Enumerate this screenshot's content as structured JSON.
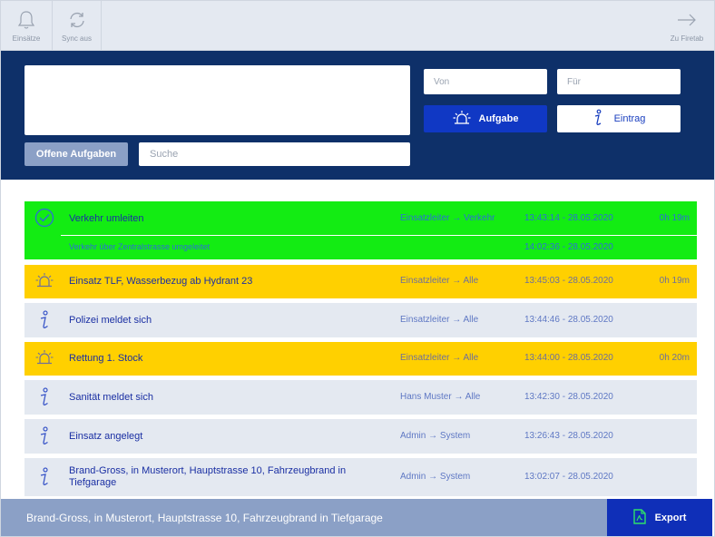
{
  "toolbar": {
    "einsaetze_label": "Einsätze",
    "sync_label": "Sync aus",
    "firetab_label": "Zu Firetab"
  },
  "panel": {
    "von_placeholder": "Von",
    "fuer_placeholder": "Für",
    "aufgabe_label": "Aufgabe",
    "eintrag_label": "Eintrag",
    "offene_label": "Offene Aufgaben",
    "suche_placeholder": "Suche"
  },
  "colors": {
    "panel_bg": "#0e3069",
    "done_green": "#13ec13",
    "alarm_yellow": "#ffd000",
    "info_grey": "#e4e9f1",
    "accent_blue": "#1038c4"
  },
  "entries": [
    {
      "type": "task-done",
      "icon": "check-circle-icon",
      "title": "Verkehr umleiten",
      "route": "Einsatzleiter → Verkehr",
      "time": "13:43:14 - 28.05.2020",
      "duration": "0h 19m",
      "sub": {
        "text": "Verkehr über Zentralstrasse umgeleitet",
        "time": "14:02:36 - 28.05.2020"
      }
    },
    {
      "type": "alarm",
      "icon": "siren-icon",
      "title": "Einsatz TLF, Wasserbezug ab Hydrant 23",
      "route": "Einsatzleiter → Alle",
      "time": "13:45:03 - 28.05.2020",
      "duration": "0h 19m"
    },
    {
      "type": "info",
      "icon": "info-icon",
      "title": "Polizei meldet sich",
      "route": "Einsatzleiter → Alle",
      "time": "13:44:46 - 28.05.2020",
      "duration": ""
    },
    {
      "type": "alarm",
      "icon": "siren-icon",
      "title": "Rettung 1. Stock",
      "route": "Einsatzleiter → Alle",
      "time": "13:44:00 - 28.05.2020",
      "duration": "0h 20m"
    },
    {
      "type": "info",
      "icon": "info-icon",
      "title": "Sanität meldet sich",
      "route": "Hans Muster → Alle",
      "time": "13:42:30 - 28.05.2020",
      "duration": ""
    },
    {
      "type": "info",
      "icon": "info-icon",
      "title": "Einsatz angelegt",
      "route": "Admin → System",
      "time": "13:26:43 - 28.05.2020",
      "duration": ""
    },
    {
      "type": "info",
      "icon": "info-icon",
      "title": "Brand-Gross, in Musterort, Hauptstrasse 10, Fahrzeugbrand in Tiefgarage",
      "route": "Admin → System",
      "time": "13:02:07 - 28.05.2020",
      "duration": ""
    }
  ],
  "footer": {
    "title": "Brand-Gross, in Musterort, Hauptstrasse 10, Fahrzeugbrand in Tiefgarage",
    "export_label": "Export"
  }
}
